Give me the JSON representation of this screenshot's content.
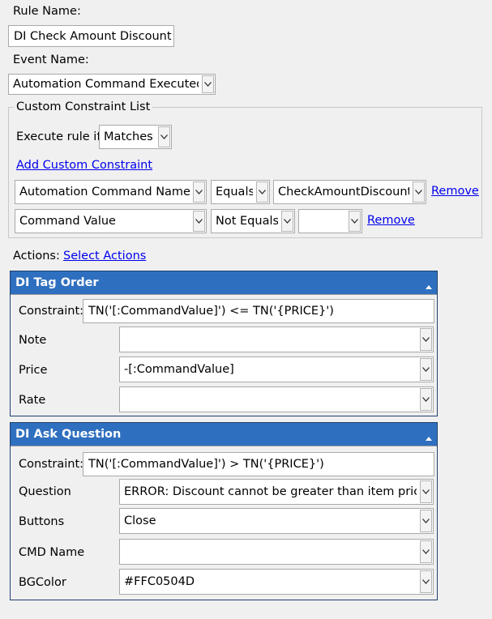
{
  "rule_name": {
    "label": "Rule Name:",
    "value": "DI Check Amount Discount"
  },
  "event_name": {
    "label": "Event Name:",
    "value": "Automation Command Executed"
  },
  "constraints": {
    "legend": "Custom Constraint List",
    "execute_label": "Execute rule if",
    "execute_value": "Matches",
    "add_link": "Add Custom Constraint",
    "rows": [
      {
        "field": "Automation Command Name",
        "operator": "Equals",
        "value": "CheckAmountDiscount",
        "remove": "Remove"
      },
      {
        "field": "Command Value",
        "operator": "Not Equals",
        "value": "",
        "remove": "Remove"
      }
    ]
  },
  "actions": {
    "label": "Actions:",
    "select_link": "Select Actions",
    "items": [
      {
        "title": "DI Tag Order",
        "constraint_label": "Constraint:",
        "constraint_value": "TN('[:CommandValue]') <= TN('{PRICE}')",
        "params": [
          {
            "label": "Note",
            "value": ""
          },
          {
            "label": "Price",
            "value": "-[:CommandValue]"
          },
          {
            "label": "Rate",
            "value": ""
          }
        ]
      },
      {
        "title": "DI Ask Question",
        "constraint_label": "Constraint:",
        "constraint_value": "TN('[:CommandValue]') > TN('{PRICE}')",
        "params": [
          {
            "label": "Question",
            "value": "ERROR: Discount cannot be greater than item price"
          },
          {
            "label": "Buttons",
            "value": "Close"
          },
          {
            "label": "CMD Name",
            "value": ""
          },
          {
            "label": "BGColor",
            "value": "#FFC0504D"
          }
        ]
      }
    ]
  },
  "colors": {
    "panel_header": "#2f6fbf",
    "link": "#0000ee",
    "background": "#f0f0f0"
  }
}
